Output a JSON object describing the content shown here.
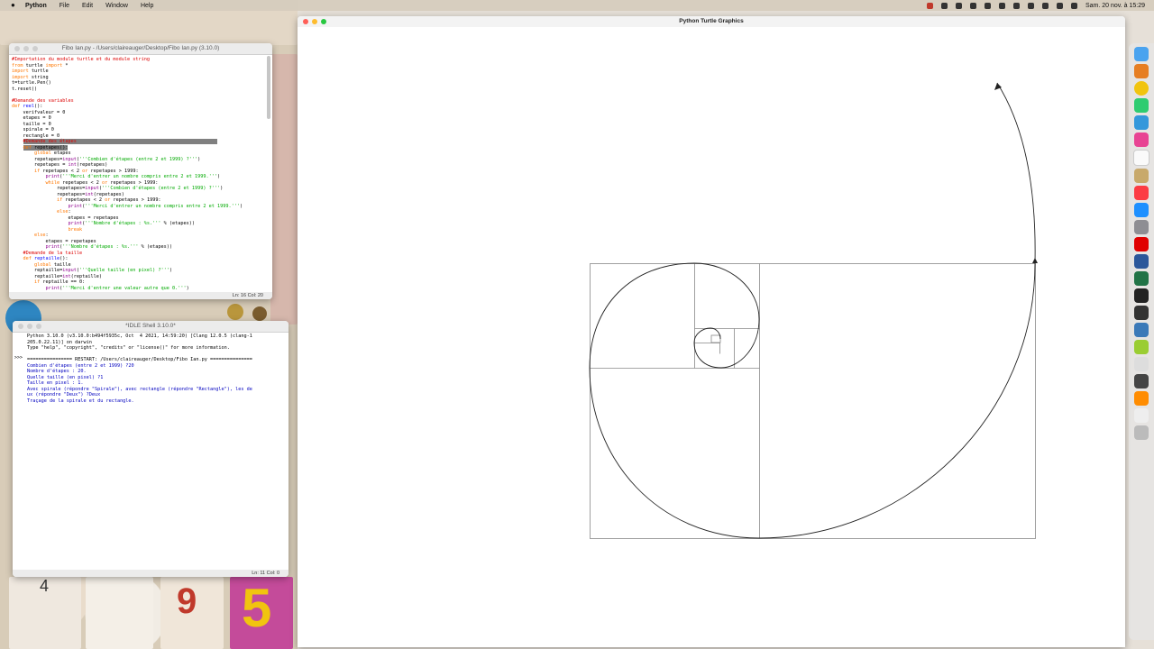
{
  "menubar": {
    "apple": "",
    "app": "Python",
    "items": [
      "File",
      "Edit",
      "Window",
      "Help"
    ],
    "clock": "Sam. 20 nov. à 15:29"
  },
  "editor": {
    "title": "Fibo Ian.py - /Users/claireauger/Desktop/Fibo Ian.py (3.10.0)",
    "status": "Ln: 16   Col: 20"
  },
  "shell": {
    "title": "*IDLE Shell 3.10.0*",
    "status": "Ln: 11   Col: 0",
    "lines": [
      "Python 3.10.0 (v3.10.0:b494f5935c, Oct  4 2021, 14:59:20) [Clang 12.0.5 (clang-1",
      "205.0.22.11)] on darwin",
      "Type \"help\", \"copyright\", \"credits\" or \"license()\" for more information.",
      "",
      "================ RESTART: /Users/claireauger/Desktop/Fibo Ian.py ===============",
      "Combien d'étapes (entre 2 et 1999) ?20",
      "Nombre d'étapes : 20.",
      "Quelle taille (en pixel) ?1",
      "Taille en pixel : 1.",
      "Avec spirale (répondre \"Spirale\"), avec rectangle (répondre \"Rectangle\"), les de",
      "ux (répondre \"Deux\") ?Deux",
      "Traçage de la spirale et du rectangle."
    ],
    "prompt": ">>>"
  },
  "turtle": {
    "title": "Python Turtle Graphics"
  },
  "colors": {
    "keyword": "#ff7700",
    "string": "#00aa00",
    "comment": "#dd0000",
    "builtin": "#900090",
    "definition": "#0000ff",
    "shell_output": "#0000c0"
  },
  "dock_icons": [
    "finder-icon",
    "launchpad-icon",
    "chrome-icon",
    "messages-icon",
    "mail-icon",
    "photos-icon",
    "calendar-icon",
    "notes-icon",
    "music-icon",
    "appstore-icon",
    "settings-icon",
    "youtube-icon",
    "word-icon",
    "excel-icon",
    "terminal-icon",
    "cmd-icon",
    "idle-icon",
    "python-icon",
    "preview-icon",
    "tv-icon",
    "books-icon",
    "files-icon",
    "trash-icon"
  ]
}
